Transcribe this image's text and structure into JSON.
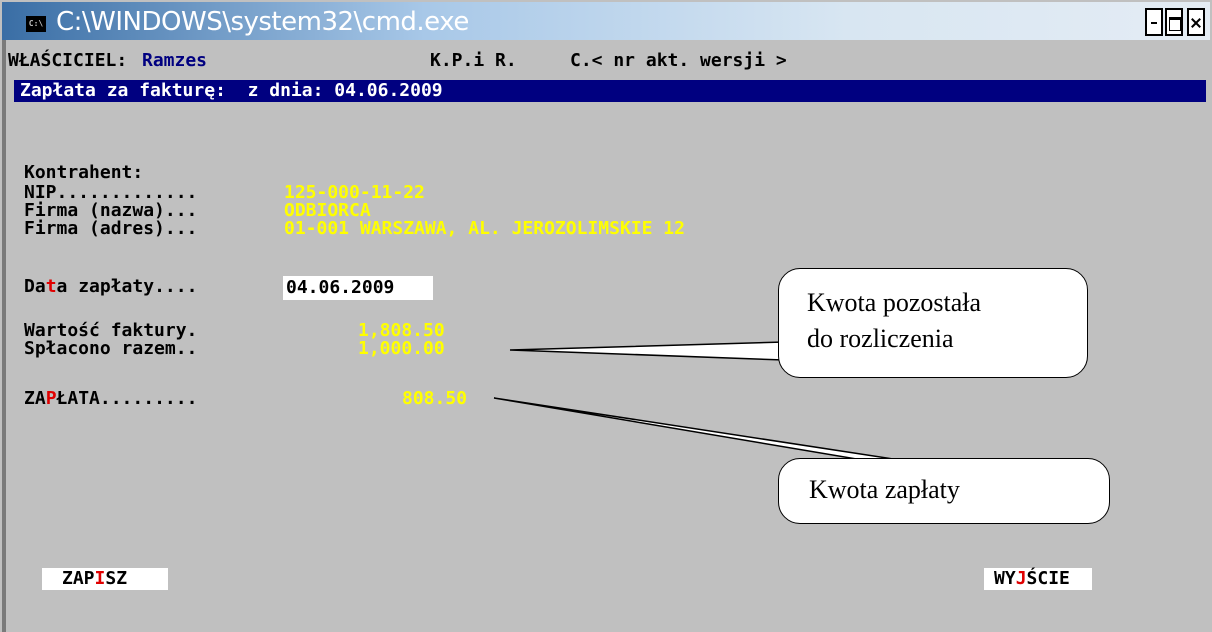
{
  "window": {
    "title": "C:\\WINDOWS\\system32\\cmd.exe",
    "icon_text": "C:\\",
    "controls": [
      "minimize",
      "maximize",
      "close"
    ]
  },
  "header": {
    "owner_label": "WŁAŚCICIEL:",
    "owner_value": "Ramzes",
    "program": "K.P.i R.",
    "version": "C.< nr akt. wersji >"
  },
  "banner": {
    "text": "Zapłata za fakturę:  z dnia: 04.06.2009"
  },
  "contractor": {
    "heading": "Kontrahent:",
    "nip_label": "NIP.............",
    "nip_value": "125-000-11-22",
    "name_label": "Firma (nazwa)...",
    "name_value": "ODBIORCA",
    "address_label": "Firma (adres)...",
    "address_value": "01-001 WARSZAWA, AL. JEROZOLIMSKIE 12"
  },
  "payment_date": {
    "label_pre": "Da",
    "label_hot": "t",
    "label_post": "a zapłaty....",
    "value": "04.06.2009"
  },
  "amounts": {
    "invoice_label": "Wartość faktury.",
    "invoice_value": "1,808.50",
    "paid_label": "Spłacono razem..",
    "paid_value": "1,000.00",
    "payment_label_pre": "ZA",
    "payment_label_hot": "P",
    "payment_label_post": "ŁATA.........",
    "payment_value": "808.50"
  },
  "buttons": {
    "save_pre": "ZAP",
    "save_hot": "I",
    "save_post": "SZ",
    "exit_pre": "WY",
    "exit_hot": "J",
    "exit_post": "ŚCIE"
  },
  "callouts": {
    "remaining_line1": "Kwota pozostała",
    "remaining_line2": "do rozliczenia",
    "payment": "Kwota zapłaty"
  },
  "colors": {
    "console_bg": "#c0c0c0",
    "banner_bg": "#000080",
    "value_fg": "#ffff00",
    "hotkey_fg": "#e00000"
  }
}
